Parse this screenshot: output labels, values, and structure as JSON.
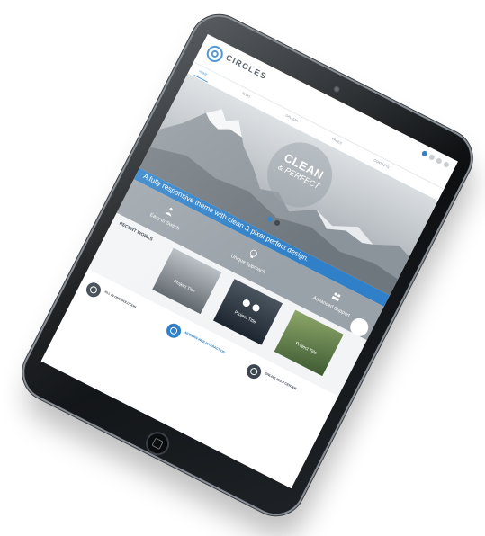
{
  "site": {
    "logo_text": "CIRCLES",
    "logo_tagline": "",
    "nav": [
      {
        "label": "HOME"
      },
      {
        "label": "BLOG"
      },
      {
        "label": "GALLERY"
      },
      {
        "label": "PAGES"
      },
      {
        "label": "CONTACTS"
      }
    ],
    "hero": {
      "title": "CLEAN",
      "subtitle": "& PERFECT",
      "caption": ""
    },
    "band": {
      "text": "A fully responsive theme with clean & pixel perfect design.",
      "subtext": ""
    },
    "features": [
      {
        "title": "Easy to Switch",
        "subtitle": ""
      },
      {
        "title": "Unique Approach",
        "subtitle": ""
      },
      {
        "title": "Advanced Support",
        "subtitle": ""
      }
    ],
    "quote_button": "",
    "recent": {
      "title": "RECENT WORKS",
      "text": "",
      "items": [
        {
          "title": "Project Title",
          "subtitle": ""
        },
        {
          "title": "Project Title",
          "subtitle": ""
        },
        {
          "title": "Project Title",
          "subtitle": ""
        }
      ]
    },
    "columns": [
      {
        "title": "ALL IN ONE SOLUTION",
        "lines": []
      },
      {
        "title": "MODERN WEB INTERACTION",
        "lines": []
      },
      {
        "title": "ONLINE HELP CENTER",
        "lines": []
      }
    ]
  }
}
